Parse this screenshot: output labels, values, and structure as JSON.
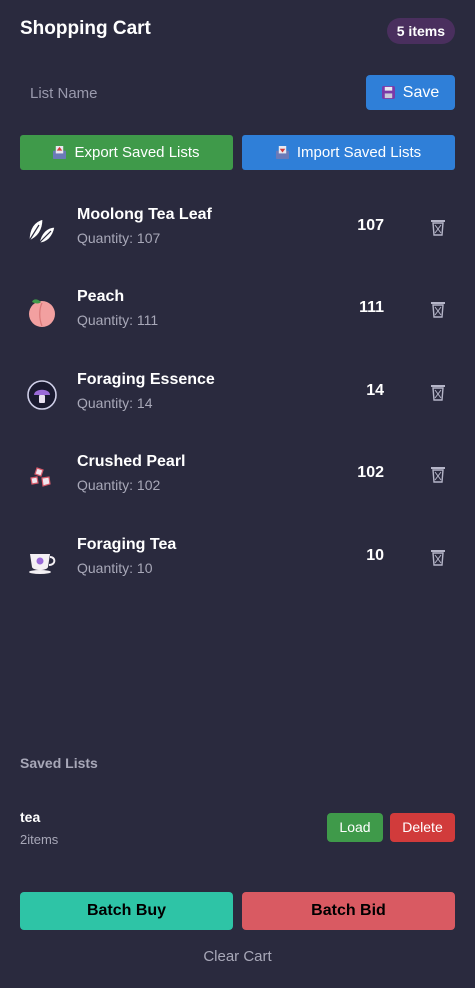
{
  "header": {
    "title": "Shopping Cart",
    "count_badge": "5 items"
  },
  "list_name": {
    "placeholder": "List Name",
    "save_label": "Save"
  },
  "transfer": {
    "export_label": "Export Saved Lists",
    "import_label": "Import Saved Lists"
  },
  "items": [
    {
      "name": "Moolong Tea Leaf",
      "quantity_text": "Quantity: 107",
      "amount": "107",
      "icon": "tea-leaf-icon"
    },
    {
      "name": "Peach",
      "quantity_text": "Quantity: 111",
      "amount": "111",
      "icon": "peach-icon"
    },
    {
      "name": "Foraging Essence",
      "quantity_text": "Quantity: 14",
      "amount": "14",
      "icon": "foraging-essence-icon"
    },
    {
      "name": "Crushed Pearl",
      "quantity_text": "Quantity: 102",
      "amount": "102",
      "icon": "crushed-pearl-icon"
    },
    {
      "name": "Foraging Tea",
      "quantity_text": "Quantity: 10",
      "amount": "10",
      "icon": "teacup-icon"
    }
  ],
  "saved_lists": {
    "label": "Saved Lists",
    "lists": [
      {
        "name": "tea",
        "count": "2items",
        "load_label": "Load",
        "delete_label": "Delete"
      }
    ]
  },
  "actions": {
    "batch_buy": "Batch Buy",
    "batch_bid": "Batch Bid",
    "clear_cart": "Clear Cart"
  },
  "colors": {
    "background": "#2a2a3e",
    "save_blue": "#2f7fd8",
    "export_green": "#3f9a4a",
    "buy_teal": "#2ec4a6",
    "bid_red": "#d95a62",
    "delete_red": "#d13b3b",
    "badge_purple": "#4a2f5e"
  }
}
